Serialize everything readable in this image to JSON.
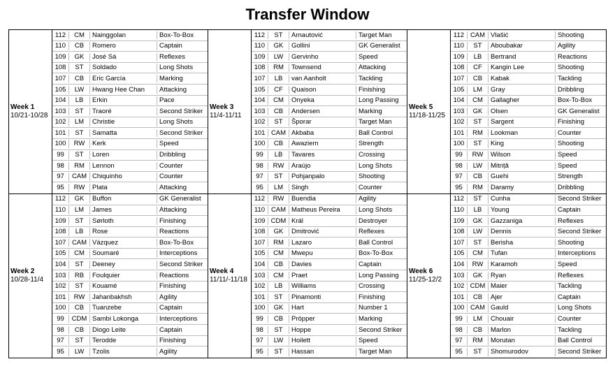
{
  "title": "Transfer Window",
  "weeks": [
    {
      "label": "Week 1",
      "dates": "10/21-10/28",
      "players": [
        {
          "rt": 112,
          "pos": "CM",
          "name": "Nainggolan",
          "trait": "Box-To-Box"
        },
        {
          "rt": 110,
          "pos": "CB",
          "name": "Romero",
          "trait": "Captain"
        },
        {
          "rt": 109,
          "pos": "GK",
          "name": "José Sá",
          "trait": "Reflexes"
        },
        {
          "rt": 108,
          "pos": "ST",
          "name": "Soldado",
          "trait": "Long Shots"
        },
        {
          "rt": 107,
          "pos": "CB",
          "name": "Eric García",
          "trait": "Marking"
        },
        {
          "rt": 105,
          "pos": "LW",
          "name": "Hwang Hee Chan",
          "trait": "Attacking"
        },
        {
          "rt": 104,
          "pos": "LB",
          "name": "Erkin",
          "trait": "Pace"
        },
        {
          "rt": 103,
          "pos": "ST",
          "name": "Traoré",
          "trait": "Second Striker"
        },
        {
          "rt": 102,
          "pos": "LM",
          "name": "Christie",
          "trait": "Long Shots"
        },
        {
          "rt": 101,
          "pos": "ST",
          "name": "Samatta",
          "trait": "Second Striker"
        },
        {
          "rt": 100,
          "pos": "RW",
          "name": "Kerk",
          "trait": "Speed"
        },
        {
          "rt": 99,
          "pos": "ST",
          "name": "Loren",
          "trait": "Dribbling"
        },
        {
          "rt": 98,
          "pos": "RM",
          "name": "Lennon",
          "trait": "Counter"
        },
        {
          "rt": 97,
          "pos": "CAM",
          "name": "Chiquinho",
          "trait": "Counter"
        },
        {
          "rt": 95,
          "pos": "RW",
          "name": "Plata",
          "trait": "Attacking"
        }
      ]
    },
    {
      "label": "Week 3",
      "dates": "11/4-11/11",
      "players": [
        {
          "rt": 112,
          "pos": "ST",
          "name": "Arnautović",
          "trait": "Target Man"
        },
        {
          "rt": 110,
          "pos": "GK",
          "name": "Gollini",
          "trait": "GK Generalist"
        },
        {
          "rt": 109,
          "pos": "LW",
          "name": "Gervinho",
          "trait": "Speed"
        },
        {
          "rt": 108,
          "pos": "RM",
          "name": "Townsend",
          "trait": "Attacking"
        },
        {
          "rt": 107,
          "pos": "LB",
          "name": "van Aanholt",
          "trait": "Tackling"
        },
        {
          "rt": 105,
          "pos": "CF",
          "name": "Quaison",
          "trait": "Finishing"
        },
        {
          "rt": 104,
          "pos": "CM",
          "name": "Onyeka",
          "trait": "Long Passing"
        },
        {
          "rt": 103,
          "pos": "CB",
          "name": "Andersen",
          "trait": "Marking"
        },
        {
          "rt": 102,
          "pos": "ST",
          "name": "Šporar",
          "trait": "Target Man"
        },
        {
          "rt": 101,
          "pos": "CAM",
          "name": "Akbaba",
          "trait": "Ball Control"
        },
        {
          "rt": 100,
          "pos": "CB",
          "name": "Awaziem",
          "trait": "Strength"
        },
        {
          "rt": 99,
          "pos": "LB",
          "name": "Tavares",
          "trait": "Crossing"
        },
        {
          "rt": 98,
          "pos": "RW",
          "name": "Araújo",
          "trait": "Long Shots"
        },
        {
          "rt": 97,
          "pos": "ST",
          "name": "Pohjanpalo",
          "trait": "Shooting"
        },
        {
          "rt": 95,
          "pos": "LM",
          "name": "Singh",
          "trait": "Counter"
        }
      ]
    },
    {
      "label": "Week 5",
      "dates": "11/18-11/25",
      "players": [
        {
          "rt": 112,
          "pos": "CAM",
          "name": "Vlašić",
          "trait": "Shooting"
        },
        {
          "rt": 110,
          "pos": "ST",
          "name": "Aboubakar",
          "trait": "Agility"
        },
        {
          "rt": 109,
          "pos": "LB",
          "name": "Bertrand",
          "trait": "Reactions"
        },
        {
          "rt": 108,
          "pos": "CF",
          "name": "Kangin Lee",
          "trait": "Shooting"
        },
        {
          "rt": 107,
          "pos": "CB",
          "name": "Kabak",
          "trait": "Tackling"
        },
        {
          "rt": 105,
          "pos": "LM",
          "name": "Gray",
          "trait": "Dribbling"
        },
        {
          "rt": 104,
          "pos": "CM",
          "name": "Gallagher",
          "trait": "Box-To-Box"
        },
        {
          "rt": 103,
          "pos": "GK",
          "name": "Olsen",
          "trait": "GK Generalist"
        },
        {
          "rt": 102,
          "pos": "ST",
          "name": "Sargent",
          "trait": "Finishing"
        },
        {
          "rt": 101,
          "pos": "RM",
          "name": "Lookman",
          "trait": "Counter"
        },
        {
          "rt": 100,
          "pos": "ST",
          "name": "King",
          "trait": "Shooting"
        },
        {
          "rt": 99,
          "pos": "RW",
          "name": "Wilson",
          "trait": "Speed"
        },
        {
          "rt": 98,
          "pos": "LW",
          "name": "Mitriță",
          "trait": "Speed"
        },
        {
          "rt": 97,
          "pos": "CB",
          "name": "Guehi",
          "trait": "Strength"
        },
        {
          "rt": 95,
          "pos": "RM",
          "name": "Daramy",
          "trait": "Dribbling"
        }
      ]
    },
    {
      "label": "Week 2",
      "dates": "10/28-11/4",
      "players": [
        {
          "rt": 112,
          "pos": "GK",
          "name": "Buffon",
          "trait": "GK Generalist"
        },
        {
          "rt": 110,
          "pos": "LM",
          "name": "James",
          "trait": "Attacking"
        },
        {
          "rt": 109,
          "pos": "ST",
          "name": "Sørloth",
          "trait": "Finishing"
        },
        {
          "rt": 108,
          "pos": "LB",
          "name": "Rose",
          "trait": "Reactions"
        },
        {
          "rt": 107,
          "pos": "CAM",
          "name": "Vázquez",
          "trait": "Box-To-Box"
        },
        {
          "rt": 105,
          "pos": "CM",
          "name": "Soumaré",
          "trait": "Interceptions"
        },
        {
          "rt": 104,
          "pos": "ST",
          "name": "Deeney",
          "trait": "Second Striker"
        },
        {
          "rt": 103,
          "pos": "RB",
          "name": "Foulquier",
          "trait": "Reactions"
        },
        {
          "rt": 102,
          "pos": "ST",
          "name": "Kouamé",
          "trait": "Finishing"
        },
        {
          "rt": 101,
          "pos": "RW",
          "name": "Jahanbakhsh",
          "trait": "Agility"
        },
        {
          "rt": 100,
          "pos": "CB",
          "name": "Tuanzebe",
          "trait": "Captain"
        },
        {
          "rt": 99,
          "pos": "CDM",
          "name": "Sambi Lokonga",
          "trait": "Interceptions"
        },
        {
          "rt": 98,
          "pos": "CB",
          "name": "Diogo Leite",
          "trait": "Captain"
        },
        {
          "rt": 97,
          "pos": "ST",
          "name": "Terodde",
          "trait": "Finishing"
        },
        {
          "rt": 95,
          "pos": "LW",
          "name": "Tzolis",
          "trait": "Agility"
        }
      ]
    },
    {
      "label": "Week 4",
      "dates": "11/11/-11/18",
      "players": [
        {
          "rt": 112,
          "pos": "RW",
          "name": "Buendia",
          "trait": "Agility"
        },
        {
          "rt": 110,
          "pos": "CAM",
          "name": "Matheus Pereira",
          "trait": "Long Shots"
        },
        {
          "rt": 109,
          "pos": "CDM",
          "name": "Král",
          "trait": "Destroyer"
        },
        {
          "rt": 108,
          "pos": "GK",
          "name": "Dmitrović",
          "trait": "Reflexes"
        },
        {
          "rt": 107,
          "pos": "RM",
          "name": "Lazaro",
          "trait": "Ball Control"
        },
        {
          "rt": 105,
          "pos": "CM",
          "name": "Mwepu",
          "trait": "Box-To-Box"
        },
        {
          "rt": 104,
          "pos": "CB",
          "name": "Davies",
          "trait": "Captain"
        },
        {
          "rt": 103,
          "pos": "CM",
          "name": "Praet",
          "trait": "Long Passing"
        },
        {
          "rt": 102,
          "pos": "LB",
          "name": "Williams",
          "trait": "Crossing"
        },
        {
          "rt": 101,
          "pos": "ST",
          "name": "Pinamonti",
          "trait": "Finishing"
        },
        {
          "rt": 100,
          "pos": "GK",
          "name": "Hart",
          "trait": "Number 1"
        },
        {
          "rt": 99,
          "pos": "CB",
          "name": "Pröpper",
          "trait": "Marking"
        },
        {
          "rt": 98,
          "pos": "ST",
          "name": "Hoppe",
          "trait": "Second Striker"
        },
        {
          "rt": 97,
          "pos": "LW",
          "name": "Hoilett",
          "trait": "Speed"
        },
        {
          "rt": 95,
          "pos": "ST",
          "name": "Hassan",
          "trait": "Target Man"
        }
      ]
    },
    {
      "label": "Week 6",
      "dates": "11/25-12/2",
      "players": [
        {
          "rt": 112,
          "pos": "ST",
          "name": "Cunha",
          "trait": "Second Striker"
        },
        {
          "rt": 110,
          "pos": "LB",
          "name": "Young",
          "trait": "Captain"
        },
        {
          "rt": 109,
          "pos": "GK",
          "name": "Gazzaniga",
          "trait": "Reflexes"
        },
        {
          "rt": 108,
          "pos": "LW",
          "name": "Dennis",
          "trait": "Second Striker"
        },
        {
          "rt": 107,
          "pos": "ST",
          "name": "Berisha",
          "trait": "Shooting"
        },
        {
          "rt": 105,
          "pos": "CM",
          "name": "Tufan",
          "trait": "Interceptions"
        },
        {
          "rt": 104,
          "pos": "RW",
          "name": "Karamoh",
          "trait": "Speed"
        },
        {
          "rt": 103,
          "pos": "GK",
          "name": "Ryan",
          "trait": "Reflexes"
        },
        {
          "rt": 102,
          "pos": "CDM",
          "name": "Maier",
          "trait": "Tackling"
        },
        {
          "rt": 101,
          "pos": "CB",
          "name": "Ajer",
          "trait": "Captain"
        },
        {
          "rt": 100,
          "pos": "CAM",
          "name": "Gauld",
          "trait": "Long Shots"
        },
        {
          "rt": 99,
          "pos": "LM",
          "name": "Chouair",
          "trait": "Counter"
        },
        {
          "rt": 98,
          "pos": "CB",
          "name": "Marlon",
          "trait": "Tackling"
        },
        {
          "rt": 97,
          "pos": "RM",
          "name": "Morutan",
          "trait": "Ball Control"
        },
        {
          "rt": 95,
          "pos": "ST",
          "name": "Shomurodov",
          "trait": "Second Striker"
        }
      ]
    }
  ]
}
